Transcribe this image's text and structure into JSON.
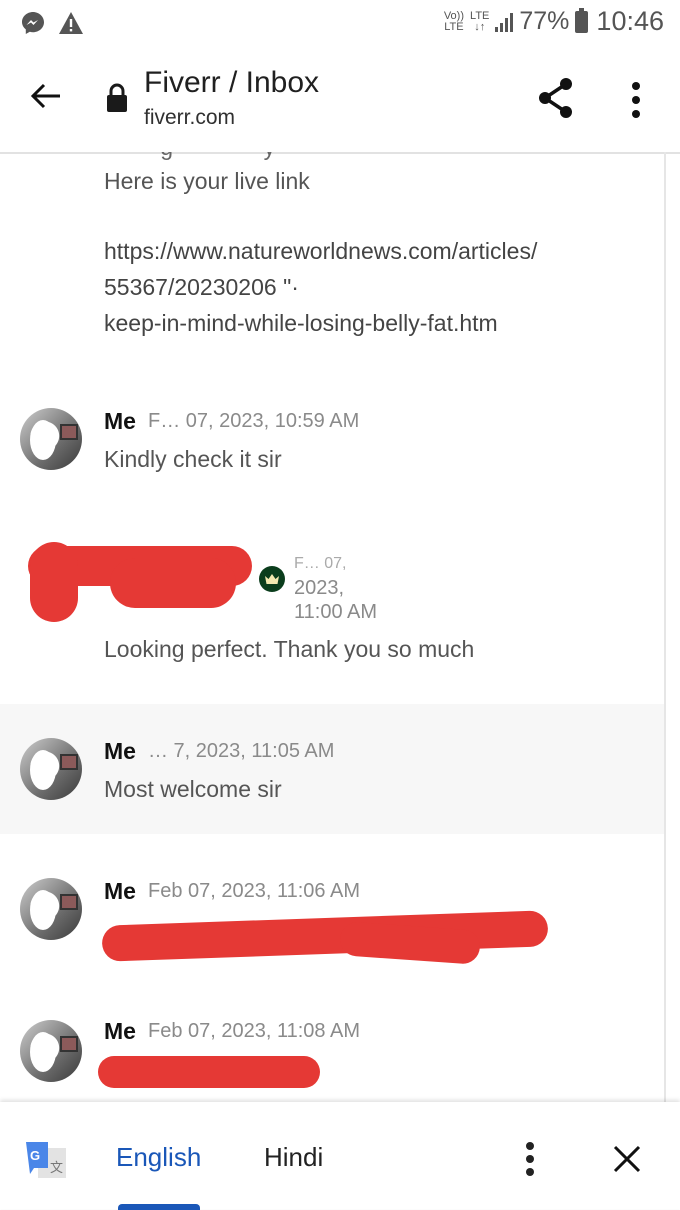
{
  "status_bar": {
    "notification_icons": [
      "messenger-icon",
      "warning-icon"
    ],
    "volte": "Vo))\nLTE",
    "network": "LTE",
    "battery_percent": "77%",
    "time": "10:46"
  },
  "app_bar": {
    "title": "Fiverr / Inbox",
    "subtitle": "fiverr.com",
    "icons": [
      "back-arrow-icon",
      "lock-icon",
      "share-icon",
      "more-vert-icon"
    ]
  },
  "conversation": {
    "clipped_previous_line": "· · · · g · · · · · · y · ·",
    "live_link_intro": "Here is your live link",
    "live_link_lines": [
      "https://www.natureworldnews.com/articles/",
      "55367/20230206 \"·",
      "keep-in-mind-while-losing-belly-fat.htm"
    ],
    "messages": [
      {
        "sender": "Me",
        "timestamp": "F… 07, 2023, 10:59 AM",
        "text": "Kindly check it sir",
        "redacted": false
      },
      {
        "sender": "[redacted]",
        "badge": "crown-icon",
        "timestamp_lines": [
          "F… 07,",
          "2023,",
          "11:00 AM"
        ],
        "text": "Looking perfect. Thank you so much",
        "redacted": false
      },
      {
        "sender": "Me",
        "timestamp": "… 7, 2023, 11:05 AM",
        "text": "Most welcome sir",
        "highlighted": true,
        "redacted": false
      },
      {
        "sender": "Me",
        "timestamp": "Feb 07, 2023, 11:06 AM",
        "text": "",
        "redacted": true
      },
      {
        "sender": "Me",
        "timestamp": "Feb 07, 2023, 11:08 AM",
        "text": "",
        "redacted": true
      }
    ]
  },
  "translate_bar": {
    "languages": [
      "English",
      "Hindi"
    ],
    "selected": "English",
    "accent_color": "#1a57b8"
  },
  "colors": {
    "redaction": "#e53935",
    "crown_badge": "#0b3d1c",
    "highlight_row": "#f7f7f7"
  }
}
